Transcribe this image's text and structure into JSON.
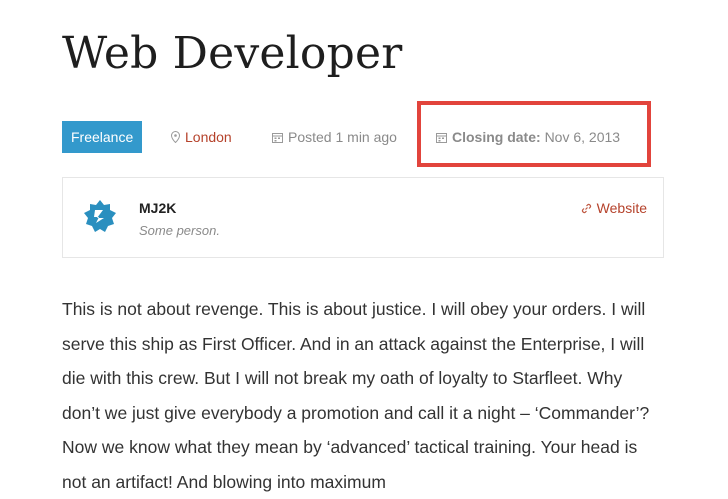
{
  "job": {
    "title": "Web Developer",
    "type_badge": "Freelance",
    "location": "London",
    "posted": "Posted 1 min ago",
    "closing_label": "Closing date:",
    "closing_value": "Nov 6, 2013"
  },
  "company": {
    "name": "MJ2K",
    "tagline": "Some person.",
    "website_label": "Website"
  },
  "description": "This is not about revenge. This is about justice. I will obey your orders. I will serve this ship as First Officer. And in an attack against the Enterprise, I will die with this crew. But I will not break my oath of loyalty to Starfleet. Why don’t we just give everybody a promotion and call it a night – ‘Commander’? Now we know what they mean by ‘advanced’ tactical training. Your head is not an artifact! And blowing into maximum",
  "icons": {
    "location": "map-pin-icon",
    "posted": "calendar-icon",
    "closing": "calendar-icon",
    "website": "link-icon",
    "logo": "company-logo"
  },
  "colors": {
    "badge_bg": "#3399cc",
    "accent_link": "#b5422b",
    "highlight_border": "#e2443c",
    "muted_text": "#8a8a8a"
  }
}
